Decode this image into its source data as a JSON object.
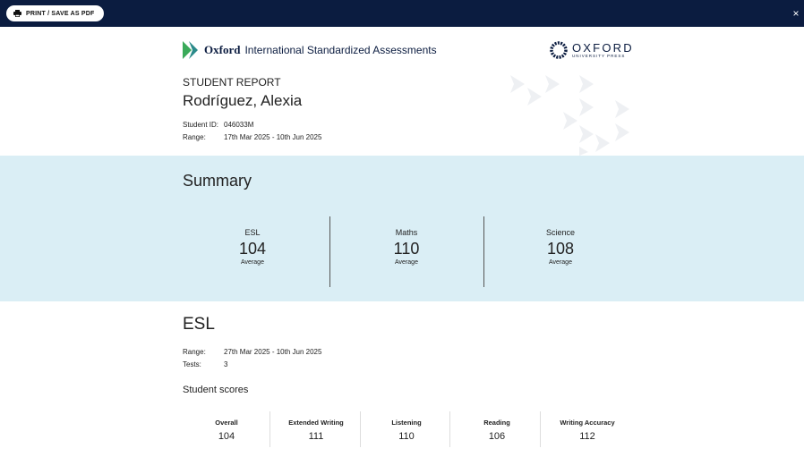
{
  "toolbar": {
    "print_label": "PRINT / SAVE AS PDF",
    "close_label": "×"
  },
  "brand": {
    "oxford": "Oxford",
    "rest": "International Standardized Assessments"
  },
  "publisher": {
    "name": "OXFORD",
    "sub": "UNIVERSITY PRESS"
  },
  "report": {
    "label": "STUDENT REPORT",
    "student_name": "Rodríguez, Alexia",
    "student_id_key": "Student ID:",
    "student_id": "046033M",
    "range_key": "Range:",
    "range": "17th Mar 2025 - 10th Jun 2025"
  },
  "summary": {
    "title": "Summary",
    "subjects": [
      {
        "name": "ESL",
        "value": "104",
        "caption": "Average"
      },
      {
        "name": "Maths",
        "value": "110",
        "caption": "Average"
      },
      {
        "name": "Science",
        "value": "108",
        "caption": "Average"
      }
    ]
  },
  "esl": {
    "title": "ESL",
    "range_key": "Range:",
    "range": "27th Mar 2025 - 10th Jun 2025",
    "tests_key": "Tests:",
    "tests": "3",
    "scores_title": "Student scores",
    "scores": [
      {
        "label": "Overall",
        "value": "104"
      },
      {
        "label": "Extended Writing",
        "value": "111"
      },
      {
        "label": "Listening",
        "value": "110"
      },
      {
        "label": "Reading",
        "value": "106"
      },
      {
        "label": "Writing Accuracy",
        "value": "112"
      }
    ]
  },
  "colors": {
    "topbar": "#0b1c40",
    "summary_bg": "#daeef5",
    "brand_green": "#3aaa5a"
  },
  "icons": {
    "print": "printer-icon",
    "close": "close-icon"
  }
}
